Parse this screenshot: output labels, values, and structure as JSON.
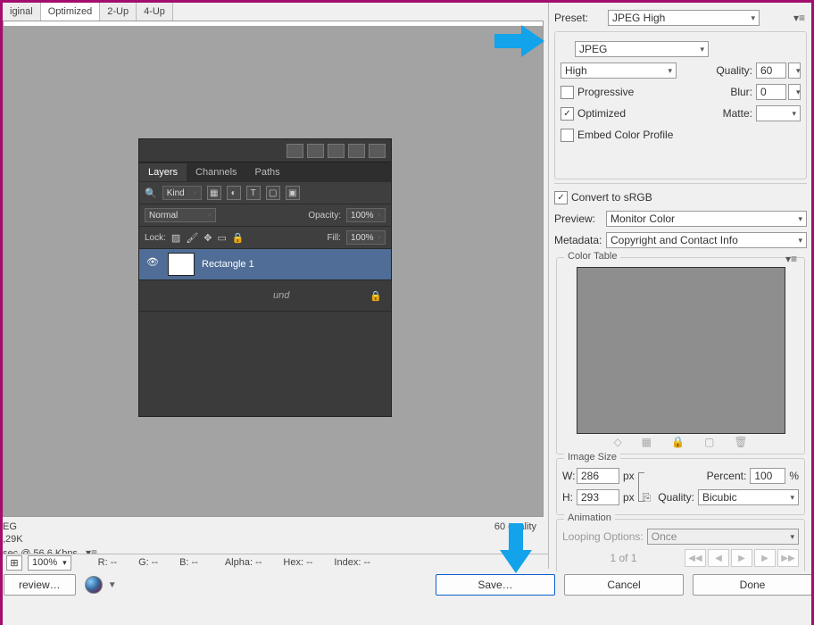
{
  "tabs": {
    "original": "iginal",
    "optimized": "Optimized",
    "twoup": "2-Up",
    "fourup": "4-Up"
  },
  "embedded_panel": {
    "tab_layers": "Layers",
    "tab_channels": "Channels",
    "tab_paths": "Paths",
    "kind_label": "Kind",
    "blend_mode": "Normal",
    "opacity_label": "Opacity:",
    "opacity_value": "100%",
    "lock_label": "Lock:",
    "fill_label": "Fill:",
    "fill_value": "100%",
    "layer1_name": "Rectangle 1",
    "layer2_suffix": "und"
  },
  "info": {
    "format": "EG",
    "size": ",29K",
    "download": "sec @ 56.6 Kbps",
    "quality_right": "60 quality"
  },
  "zoombar": {
    "zoom": "100%",
    "r": "R: --",
    "g": "G: --",
    "b": "B: --",
    "alpha": "Alpha: --",
    "hex": "Hex: --",
    "index": "Index: --"
  },
  "bottom": {
    "preview": "review…",
    "save": "Save…",
    "cancel": "Cancel",
    "done": "Done"
  },
  "right": {
    "preset_label": "Preset:",
    "preset_value": "JPEG High",
    "format_value": "JPEG",
    "quality_select": "High",
    "quality_label": "Quality:",
    "quality_value": "60",
    "progressive": "Progressive",
    "blur_label": "Blur:",
    "blur_value": "0",
    "optimized": "Optimized",
    "matte_label": "Matte:",
    "embed_profile": "Embed Color Profile",
    "convert_srgb": "Convert to sRGB",
    "preview_label": "Preview:",
    "preview_value": "Monitor Color",
    "metadata_label": "Metadata:",
    "metadata_value": "Copyright and Contact Info",
    "color_table": "Color Table",
    "image_size": "Image Size",
    "w_label": "W:",
    "w_value": "286",
    "px": "px",
    "h_label": "H:",
    "h_value": "293",
    "percent_label": "Percent:",
    "percent_value": "100",
    "percent_sign": "%",
    "imgq_label": "Quality:",
    "imgq_value": "Bicubic",
    "animation": "Animation",
    "looping_label": "Looping Options:",
    "looping_value": "Once",
    "frame": "1 of 1"
  }
}
